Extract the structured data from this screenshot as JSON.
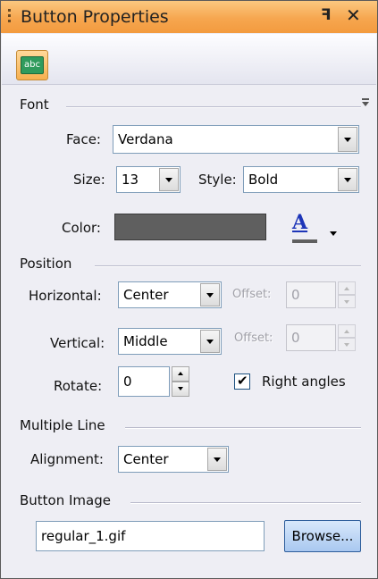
{
  "window": {
    "title": "Button Properties",
    "pin_glyph": "ꟻ",
    "close_glyph": "✕"
  },
  "toolbar": {
    "tool_icon": "text-style-icon",
    "tool_icon_text": "abc"
  },
  "font": {
    "section": "Font",
    "face_label": "Face:",
    "face_value": "Verdana",
    "size_label": "Size:",
    "size_value": "13",
    "style_label": "Style:",
    "style_value": "Bold",
    "color_label": "Color:",
    "color_value": "#5f5f5f",
    "font_color_glyph": "A"
  },
  "position": {
    "section": "Position",
    "horizontal_label": "Horizontal:",
    "horizontal_value": "Center",
    "h_offset_label": "Offset:",
    "h_offset_value": "0",
    "vertical_label": "Vertical:",
    "vertical_value": "Middle",
    "v_offset_label": "Offset:",
    "v_offset_value": "0",
    "rotate_label": "Rotate:",
    "rotate_value": "0",
    "right_angles_label": "Right angles",
    "right_angles_checked": true
  },
  "multiline": {
    "section": "Multiple Line",
    "alignment_label": "Alignment:",
    "alignment_value": "Center"
  },
  "image": {
    "section": "Button Image",
    "file_value": "regular_1.gif",
    "browse_label": "Browse..."
  }
}
